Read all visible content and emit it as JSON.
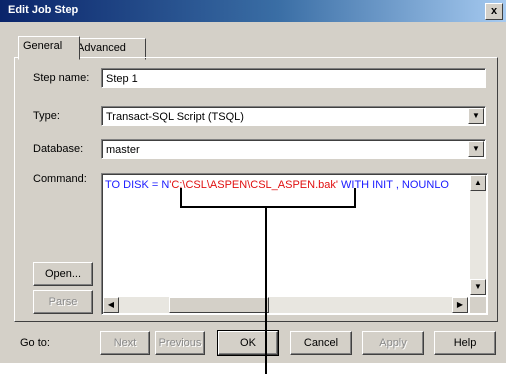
{
  "window": {
    "title": "Edit Job Step",
    "close_glyph": "x"
  },
  "tabs": [
    {
      "label": "General",
      "selected": true
    },
    {
      "label": "Advanced",
      "selected": false
    }
  ],
  "form": {
    "step_name": {
      "label": "Step name:",
      "value": "Step 1"
    },
    "type": {
      "label": "Type:",
      "value": "Transact-SQL Script (TSQL)"
    },
    "database": {
      "label": "Database:",
      "value": "master"
    },
    "command": {
      "label": "Command:",
      "text_pre": "TO DISK = N",
      "text_path": "'C:\\CSL\\ASPEN\\CSL_ASPEN.bak'",
      "text_post": " WITH INIT ,  NOUNLO"
    }
  },
  "side_buttons": {
    "open": "Open...",
    "parse": "Parse"
  },
  "footer": {
    "goto_label": "Go to:",
    "buttons": {
      "next": "Next",
      "previous": "Previous",
      "ok": "OK",
      "cancel": "Cancel",
      "apply": "Apply",
      "help": "Help"
    }
  },
  "icons": {
    "dropdown": "dropdown-arrow-icon",
    "scroll_up": "scroll-up-icon",
    "scroll_down": "scroll-down-icon",
    "scroll_left": "scroll-left-icon",
    "scroll_right": "scroll-right-icon"
  },
  "colors": {
    "titlebar_start": "#0a246a",
    "titlebar_end": "#a6caf0",
    "dialog_bg": "#d4d0c8",
    "command_blue": "#1a1aff",
    "command_red": "#e01010"
  }
}
